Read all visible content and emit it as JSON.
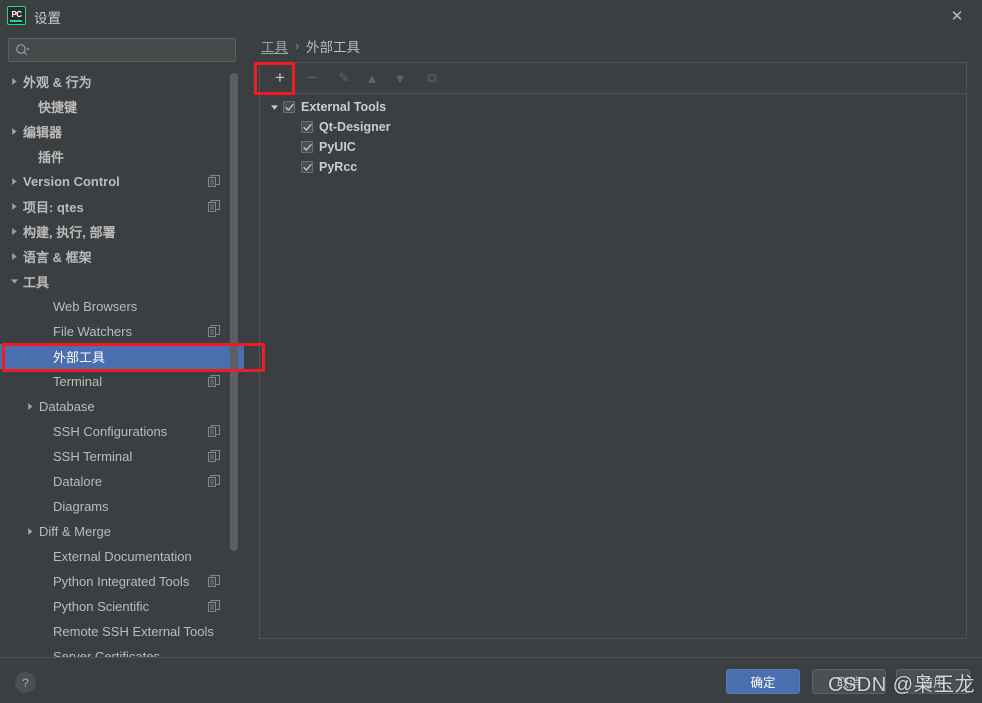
{
  "window": {
    "title": "设置",
    "logo_text": "PC",
    "close_label": "✕"
  },
  "sidebar": {
    "search": {
      "value": "",
      "placeholder": ""
    },
    "items": [
      {
        "label": "外观 & 行为",
        "arrow": "right",
        "bold": true,
        "indent": 8,
        "copy": false,
        "selected": false
      },
      {
        "label": "快捷键",
        "arrow": "none",
        "bold": true,
        "indent": 23,
        "copy": false,
        "selected": false
      },
      {
        "label": "编辑器",
        "arrow": "right",
        "bold": true,
        "indent": 8,
        "copy": false,
        "selected": false
      },
      {
        "label": "插件",
        "arrow": "none",
        "bold": true,
        "indent": 23,
        "copy": false,
        "selected": false
      },
      {
        "label": "Version Control",
        "arrow": "right",
        "bold": true,
        "indent": 8,
        "copy": true,
        "selected": false
      },
      {
        "label": "项目: qtes",
        "arrow": "right",
        "bold": true,
        "indent": 8,
        "copy": true,
        "selected": false
      },
      {
        "label": "构建, 执行, 部署",
        "arrow": "right",
        "bold": true,
        "indent": 8,
        "copy": false,
        "selected": false
      },
      {
        "label": "语言 & 框架",
        "arrow": "right",
        "bold": true,
        "indent": 8,
        "copy": false,
        "selected": false
      },
      {
        "label": "工具",
        "arrow": "down",
        "bold": true,
        "indent": 8,
        "copy": false,
        "selected": false
      },
      {
        "label": "Web Browsers",
        "arrow": "none",
        "bold": false,
        "indent": 38,
        "copy": false,
        "selected": false
      },
      {
        "label": "File Watchers",
        "arrow": "none",
        "bold": false,
        "indent": 38,
        "copy": true,
        "selected": false
      },
      {
        "label": "外部工具",
        "arrow": "none",
        "bold": false,
        "indent": 38,
        "copy": false,
        "selected": true
      },
      {
        "label": "Terminal",
        "arrow": "none",
        "bold": false,
        "indent": 38,
        "copy": true,
        "selected": false
      },
      {
        "label": "Database",
        "arrow": "right",
        "bold": false,
        "indent": 24,
        "copy": false,
        "selected": false
      },
      {
        "label": "SSH Configurations",
        "arrow": "none",
        "bold": false,
        "indent": 38,
        "copy": true,
        "selected": false
      },
      {
        "label": "SSH Terminal",
        "arrow": "none",
        "bold": false,
        "indent": 38,
        "copy": true,
        "selected": false
      },
      {
        "label": "Datalore",
        "arrow": "none",
        "bold": false,
        "indent": 38,
        "copy": true,
        "selected": false
      },
      {
        "label": "Diagrams",
        "arrow": "none",
        "bold": false,
        "indent": 38,
        "copy": false,
        "selected": false
      },
      {
        "label": "Diff & Merge",
        "arrow": "right",
        "bold": false,
        "indent": 24,
        "copy": false,
        "selected": false
      },
      {
        "label": "External Documentation",
        "arrow": "none",
        "bold": false,
        "indent": 38,
        "copy": false,
        "selected": false
      },
      {
        "label": "Python Integrated Tools",
        "arrow": "none",
        "bold": false,
        "indent": 38,
        "copy": true,
        "selected": false
      },
      {
        "label": "Python Scientific",
        "arrow": "none",
        "bold": false,
        "indent": 38,
        "copy": true,
        "selected": false
      },
      {
        "label": "Remote SSH External Tools",
        "arrow": "none",
        "bold": false,
        "indent": 38,
        "copy": false,
        "selected": false
      },
      {
        "label": "Server Certificates",
        "arrow": "none",
        "bold": false,
        "indent": 38,
        "copy": false,
        "selected": false
      }
    ]
  },
  "main": {
    "breadcrumb": {
      "parent": "工具",
      "separator": "›",
      "current": "外部工具"
    },
    "toolbar": [
      {
        "name": "add",
        "glyph": "+",
        "enabled": true
      },
      {
        "name": "remove",
        "glyph": "−",
        "enabled": false
      },
      {
        "name": "edit",
        "glyph": "✎",
        "enabled": false
      },
      {
        "name": "move-up",
        "glyph": "▲",
        "enabled": false
      },
      {
        "name": "move-down",
        "glyph": "▼",
        "enabled": false
      },
      {
        "name": "copy",
        "glyph": "⧉",
        "enabled": false
      }
    ],
    "tree": [
      {
        "label": "External Tools",
        "level": 0,
        "checked": true,
        "expanded": true
      },
      {
        "label": "Qt-Designer",
        "level": 1,
        "checked": true,
        "expanded": false
      },
      {
        "label": "PyUIC",
        "level": 1,
        "checked": true,
        "expanded": false
      },
      {
        "label": "PyRcc",
        "level": 1,
        "checked": true,
        "expanded": false
      }
    ]
  },
  "footer": {
    "help_label": "?",
    "ok_label": "确定",
    "cancel_label": "取消",
    "apply_label": "应用"
  },
  "watermark": {
    "text": "CSDN @枭玉龙"
  },
  "colors": {
    "background": "#3c3f41",
    "selection": "#4b6eaf",
    "annotation": "#ee1c25",
    "accent_green": "#21d789",
    "text": "#bbbbbb"
  }
}
